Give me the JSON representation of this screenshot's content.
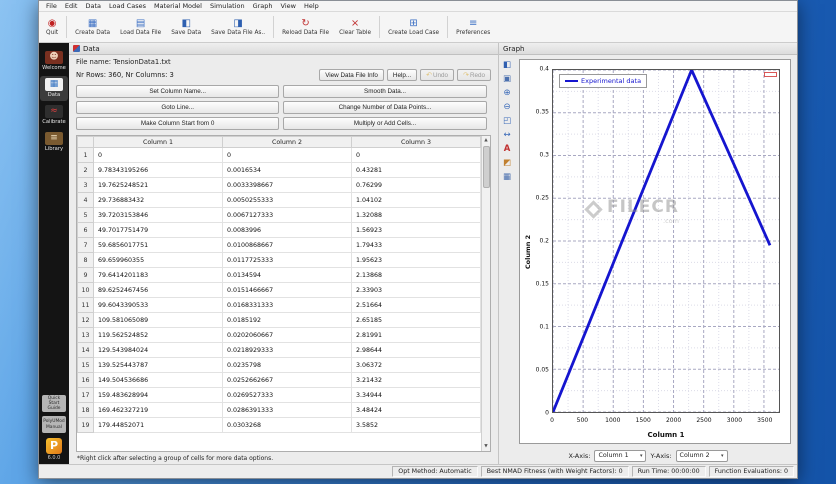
{
  "menubar": {
    "items": [
      "File",
      "Edit",
      "Data",
      "Load Cases",
      "Material Model",
      "Simulation",
      "Graph",
      "View",
      "Help"
    ]
  },
  "toolbar": {
    "separators_before": [
      1,
      5,
      7,
      8
    ],
    "buttons": [
      {
        "label": "Quit",
        "icon": "power-icon",
        "glyph": "◉",
        "color": "#c02020"
      },
      {
        "label": "Create Data",
        "icon": "new-table-icon",
        "glyph": "▦",
        "color": "#3b6fc4"
      },
      {
        "label": "Load Data File",
        "icon": "open-file-icon",
        "glyph": "▤",
        "color": "#3b6fc4"
      },
      {
        "label": "Save Data",
        "icon": "save-icon",
        "glyph": "◧",
        "color": "#2d5fb0"
      },
      {
        "label": "Save Data File As..",
        "icon": "save-as-icon",
        "glyph": "◨",
        "color": "#2d5fb0"
      },
      {
        "label": "Reload Data File",
        "icon": "reload-icon",
        "glyph": "↻",
        "color": "#c03030"
      },
      {
        "label": "Clear Table",
        "icon": "clear-table-icon",
        "glyph": "×",
        "color": "#c03030"
      },
      {
        "label": "Create Load Case",
        "icon": "add-load-case-icon",
        "glyph": "⊞",
        "color": "#3b6fc4"
      },
      {
        "label": "Preferences",
        "icon": "preferences-icon",
        "glyph": "≡",
        "color": "#3b6fc4"
      }
    ]
  },
  "sidebar": {
    "items": [
      {
        "label": "Welcome",
        "icon": "welcome-icon",
        "glyph": "☻",
        "fg": "#ecd0b8",
        "bg": "#7a3020",
        "active": false
      },
      {
        "label": "Data",
        "icon": "data-icon",
        "glyph": "▦",
        "fg": "#2f6fc0",
        "bg": "#f2f2f2",
        "active": true
      },
      {
        "label": "Calibrate",
        "icon": "calibrate-icon",
        "glyph": "≈",
        "fg": "#e04040",
        "bg": "#2e2e2e",
        "active": false
      },
      {
        "label": "Library",
        "icon": "library-icon",
        "glyph": "≡",
        "fg": "#f2e2c2",
        "bg": "#7a5a30",
        "active": false
      }
    ],
    "bottom_items": [
      {
        "label": "Quick Start Guide",
        "icon": "quick-start-guide-icon"
      },
      {
        "label": "PolyUMod Manual",
        "icon": "polyumod-manual-icon"
      }
    ],
    "logo_letter": "P",
    "version": "6.0.0"
  },
  "data_panel": {
    "title": "Data",
    "file_name_label": "File name: TensionData1.txt",
    "info_label": "Nr Rows: 360, Nr Columns: 3",
    "buttons": {
      "view_info": "View Data File Info",
      "help": "Help...",
      "undo": "Undo",
      "undo_glyph": "↶",
      "redo": "Redo",
      "redo_glyph": "↷",
      "set_column_name": "Set Column Name...",
      "smooth_data": "Smooth Data...",
      "goto_line": "Goto Line...",
      "change_points": "Change Number of Data Points...",
      "make_start_zero": "Make Column Start from 0",
      "multiply_add": "Multiply or Add Cells..."
    },
    "table": {
      "columns": [
        "Column 1",
        "Column 2",
        "Column 3"
      ],
      "rows": [
        [
          "0",
          "0",
          "0"
        ],
        [
          "9.78343195266",
          "0.0016534",
          "0.43281"
        ],
        [
          "19.7625248521",
          "0.0033398667",
          "0.76299"
        ],
        [
          "29.736883432",
          "0.0050255333",
          "1.04102"
        ],
        [
          "39.7203153846",
          "0.0067127333",
          "1.32088"
        ],
        [
          "49.7017751479",
          "0.0083996",
          "1.56923"
        ],
        [
          "59.6856017751",
          "0.0100868667",
          "1.79433"
        ],
        [
          "69.659960355",
          "0.0117725333",
          "1.95623"
        ],
        [
          "79.6414201183",
          "0.0134594",
          "2.13868"
        ],
        [
          "89.6252467456",
          "0.0151466667",
          "2.33903"
        ],
        [
          "99.6043390533",
          "0.0168331333",
          "2.51664"
        ],
        [
          "109.581065089",
          "0.0185192",
          "2.65185"
        ],
        [
          "119.562524852",
          "0.0202060667",
          "2.81991"
        ],
        [
          "129.543984024",
          "0.0218929333",
          "2.98644"
        ],
        [
          "139.525443787",
          "0.0235798",
          "3.06372"
        ],
        [
          "149.504536686",
          "0.0252662667",
          "3.21432"
        ],
        [
          "159.483628994",
          "0.0269527333",
          "3.34944"
        ],
        [
          "169.462327219",
          "0.0286391333",
          "3.48424"
        ],
        [
          "179.44852071",
          "0.0303268",
          "3.5852"
        ]
      ]
    },
    "footnote": "*Right click after selecting a group of cells for more data options."
  },
  "graph_panel": {
    "title": "Graph",
    "tools": [
      {
        "name": "save-plot-icon",
        "glyph": "◧",
        "color": "#2f5fb0"
      },
      {
        "name": "copy-plot-icon",
        "glyph": "▣",
        "color": "#4a6fae"
      },
      {
        "name": "zoom-in-icon",
        "glyph": "⊕",
        "color": "#3a6ab8"
      },
      {
        "name": "zoom-out-icon",
        "glyph": "⊖",
        "color": "#3a6ab8"
      },
      {
        "name": "zoom-region-icon",
        "glyph": "◰",
        "color": "#3a6ab8"
      },
      {
        "name": "pan-icon",
        "glyph": "↔",
        "color": "#3a6ab8"
      },
      {
        "name": "text-label-icon",
        "glyph": "A",
        "color": "#c03030"
      },
      {
        "name": "palette-icon",
        "glyph": "◩",
        "color": "#c08030"
      },
      {
        "name": "grid-icon",
        "glyph": "▦",
        "color": "#4a6fae"
      }
    ],
    "x_axis_label": "X-Axis:",
    "y_axis_label": "Y-Axis:",
    "x_axis_value": "Column 1",
    "y_axis_value": "Column 2"
  },
  "chart_data": {
    "type": "line",
    "title": "",
    "xlabel": "Column 1",
    "ylabel": "Column 2",
    "xlim": [
      0,
      3750
    ],
    "ylim": [
      0,
      0.4
    ],
    "xticks": [
      0,
      500,
      1000,
      1500,
      2000,
      2500,
      3000,
      3500
    ],
    "yticks": [
      0,
      0.05,
      0.1,
      0.15,
      0.2,
      0.25,
      0.3,
      0.35,
      0.4
    ],
    "grid": true,
    "legend_position": "top-left",
    "series": [
      {
        "name": "Experimental data",
        "color": "#1515cf",
        "points": [
          [
            0,
            0
          ],
          [
            600,
            0.104
          ],
          [
            1200,
            0.209
          ],
          [
            1800,
            0.313
          ],
          [
            2300,
            0.4
          ],
          [
            3000,
            0.29
          ],
          [
            3600,
            0.195
          ]
        ]
      }
    ]
  },
  "status_bar": {
    "segments": [
      {
        "name": "opt-method-status",
        "text": "Opt Method: Automatic"
      },
      {
        "name": "best-fitness-status",
        "text": "Best NMAD Fitness (with Weight Factors): 0"
      },
      {
        "name": "run-time-status",
        "text": "Run Time: 00:00:00"
      },
      {
        "name": "function-evaluations-status",
        "text": "Function Evaluations: 0"
      }
    ]
  },
  "watermark": {
    "text": "FILECR",
    "suffix": ".com"
  }
}
